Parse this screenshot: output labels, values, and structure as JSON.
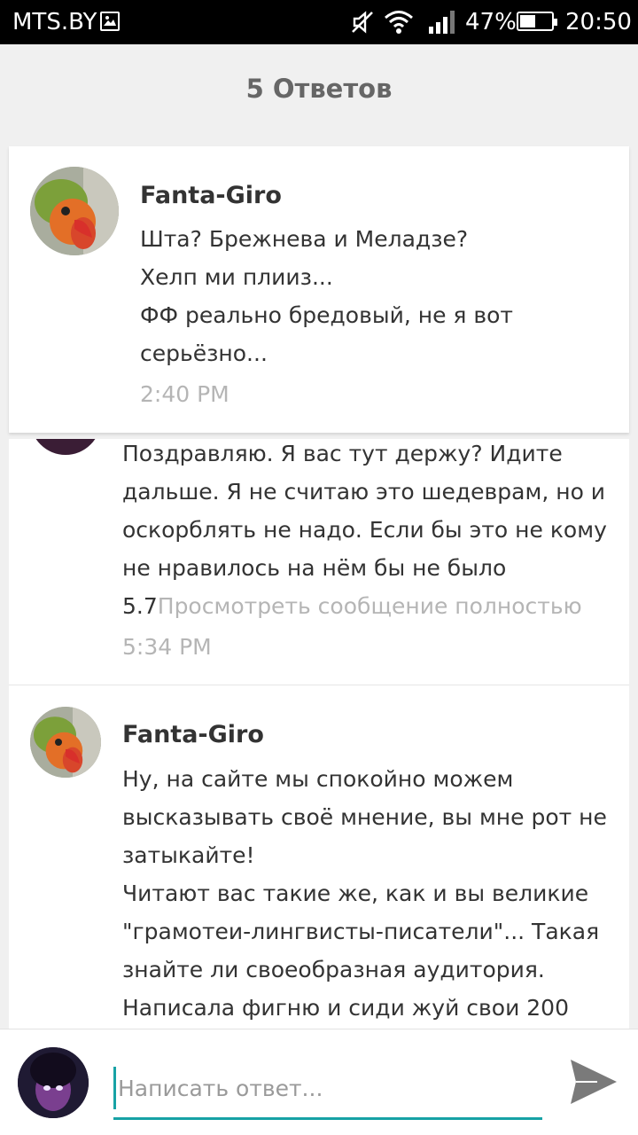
{
  "status_bar": {
    "carrier": "MTS.BY",
    "battery": "47%",
    "time": "20:50"
  },
  "header": {
    "title": "5 Ответов"
  },
  "replies": [
    {
      "author": "Fanta-Giro",
      "lines": [
        "Шта? Брежнева и Меладзе?",
        "Хелп ми плииз...",
        "ФФ реально бредовый, не я вот",
        "серьёзно..."
      ],
      "time": "2:40 PM"
    },
    {
      "lines": [
        "Поздравляю. Я вас тут держу? Идите",
        "дальше. Я не считаю это шедеврам, но и",
        "оскорблять не надо. Если бы это не кому",
        "не нравилось на нём бы не было"
      ],
      "last_line": "5.7",
      "more_link": "Просмотреть сообщение полностью",
      "time": "5:34 PM"
    },
    {
      "author": "Fanta-Giro",
      "lines": [
        "Ну, на сайте мы спокойно можем",
        "высказывать своё мнение, вы мне рот не",
        "затыкайте!",
        "Читают вас такие же, как и вы великие",
        "\"грамотеи-лингвисты-писатели\"... Такая",
        "знайте ли своеобразная аудитория.",
        "Написала фигню и сиди жуй свои 200"
      ]
    }
  ],
  "composer": {
    "placeholder": "Написать ответ..."
  },
  "icons": {
    "mute": "mute-icon",
    "wifi": "wifi-icon",
    "signal": "signal-icon",
    "battery": "battery-icon",
    "send": "send-icon"
  },
  "colors": {
    "accent": "#17a2a5",
    "muted": "#b5b5b5",
    "background": "#f0f0f0"
  }
}
